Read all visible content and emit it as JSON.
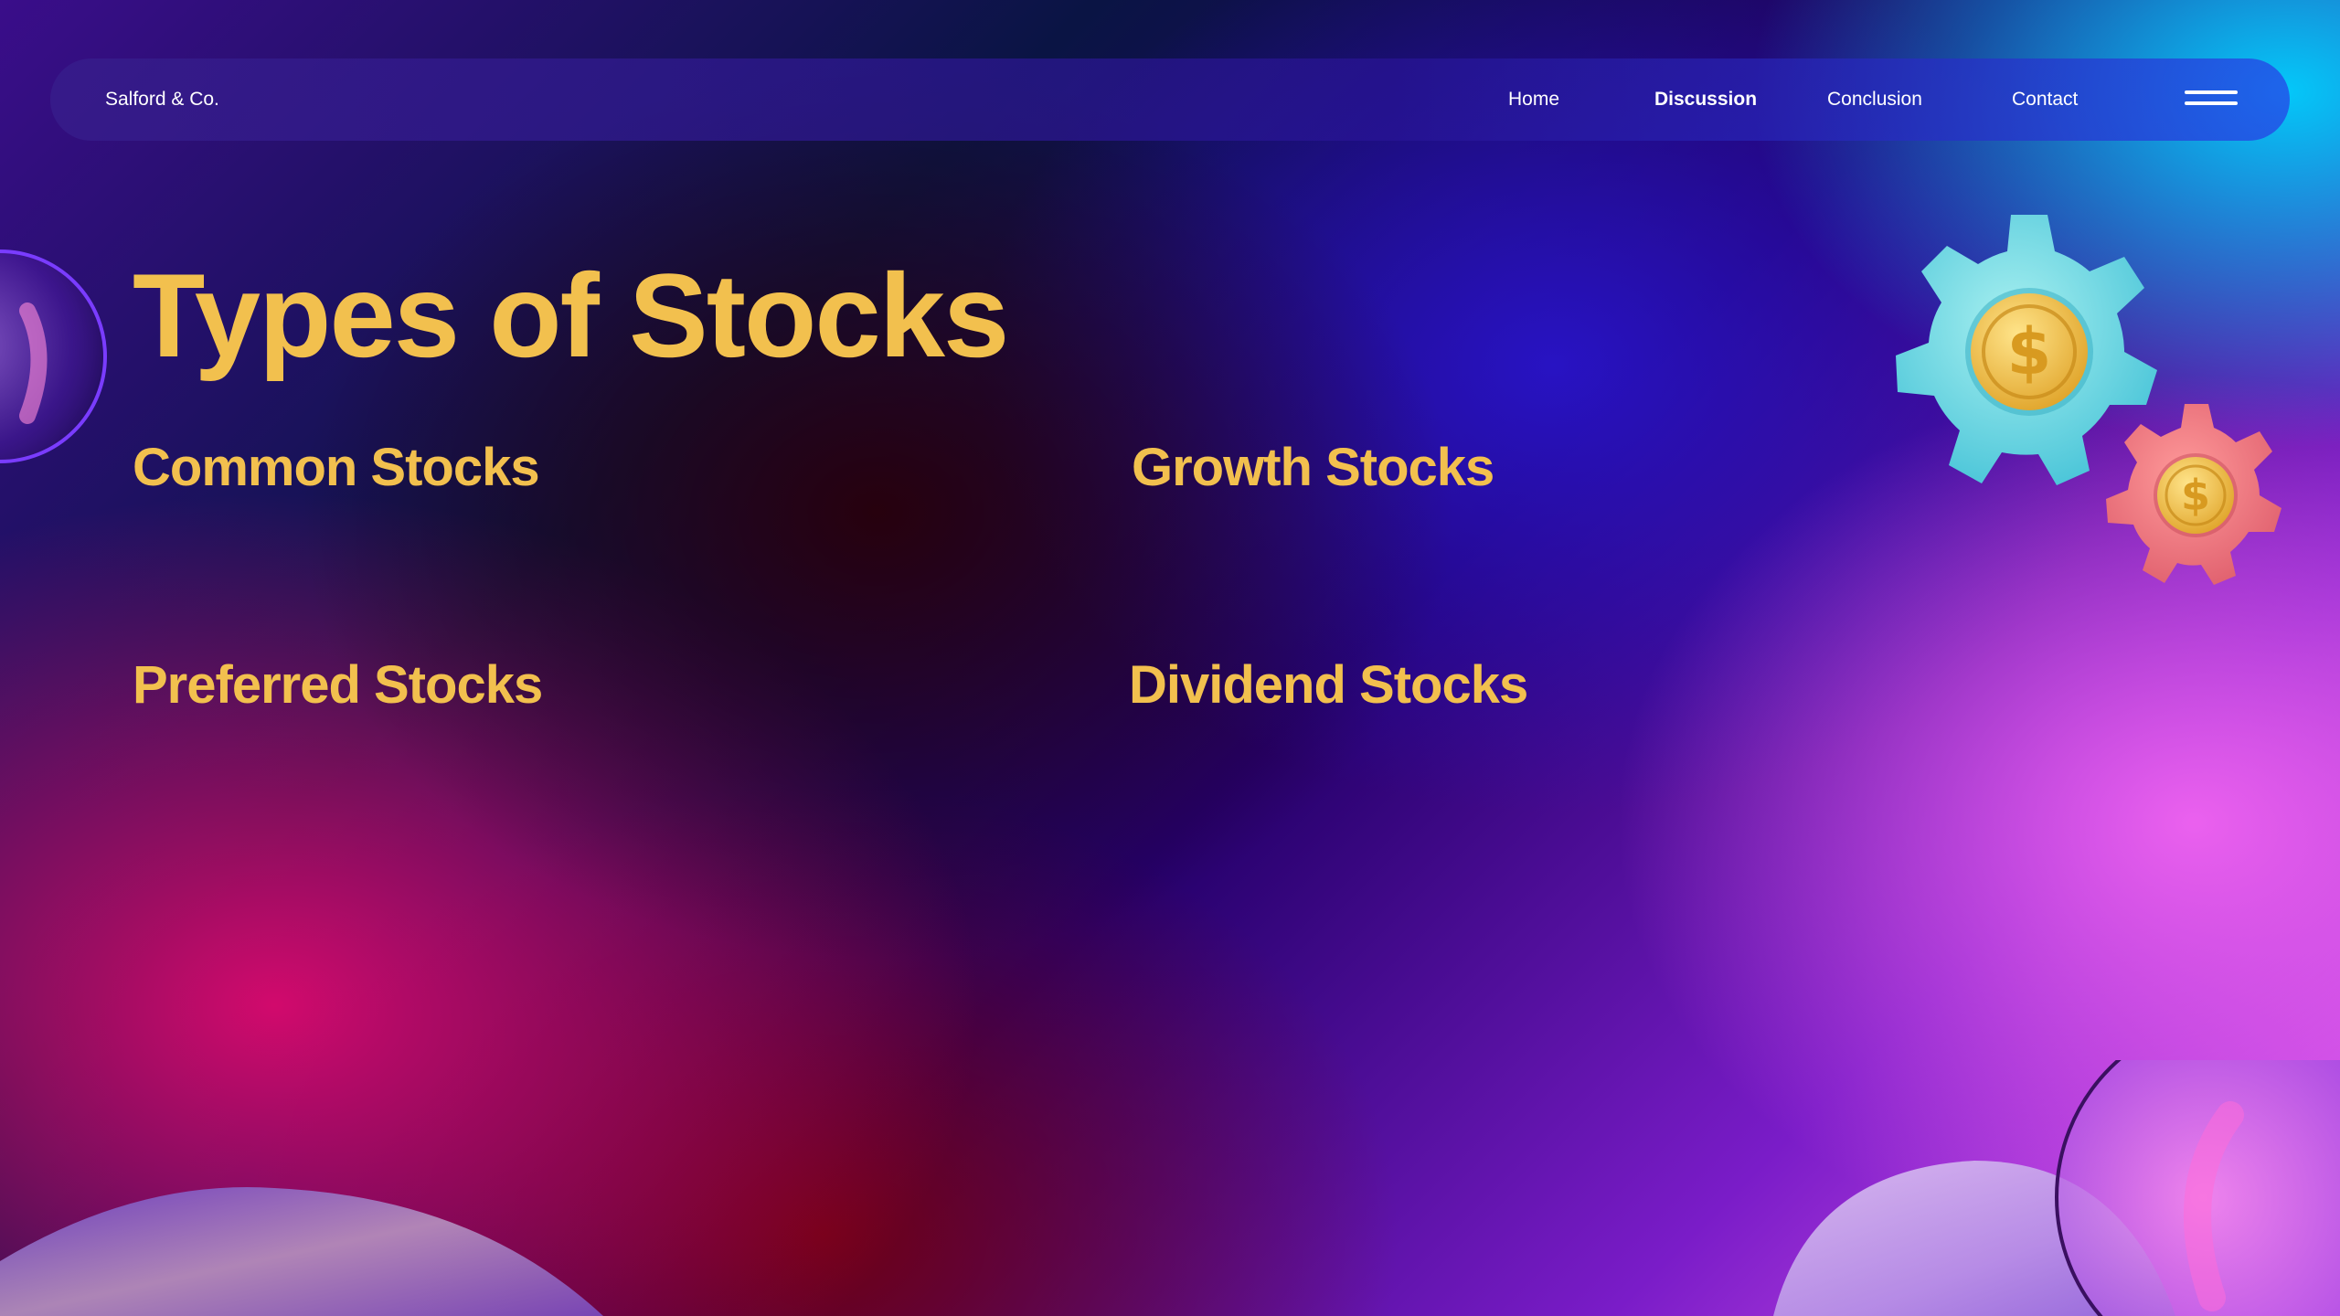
{
  "nav": {
    "brand": "Salford & Co.",
    "links": [
      {
        "label": "Home",
        "active": false
      },
      {
        "label": "Discussion",
        "active": true
      },
      {
        "label": "Conclusion",
        "active": false
      },
      {
        "label": "Contact",
        "active": false
      }
    ],
    "menu_icon": "hamburger-menu-icon"
  },
  "main": {
    "title": "Types of Stocks",
    "stock_types": [
      "Common Stocks",
      "Growth Stocks",
      "Preferred Stocks",
      "Dividend Stocks"
    ]
  },
  "decorations": {
    "large_gear_icon": "gear-coin-icon",
    "small_gear_icon": "gear-coin-icon"
  },
  "colors": {
    "heading": "#f2c04e",
    "nav_text": "#ffffff"
  }
}
